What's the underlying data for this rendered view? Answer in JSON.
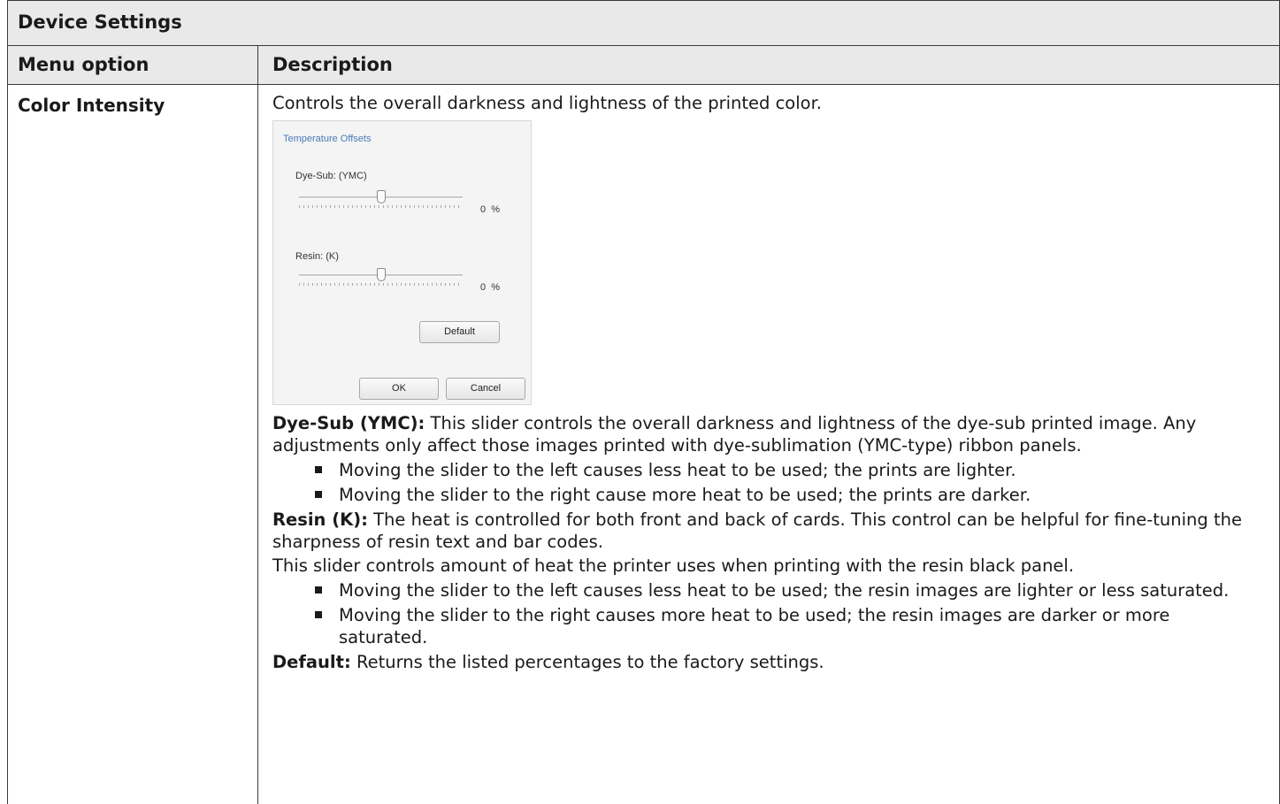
{
  "table": {
    "title": "Device Settings",
    "columns": [
      "Menu option",
      "Description"
    ],
    "row": {
      "option": "Color Intensity",
      "intro": "Controls the overall darkness and lightness of the printed color."
    }
  },
  "dialog": {
    "group_title": "Temperature Offsets",
    "dye_label": "Dye-Sub: (YMC)",
    "dye_value": "0",
    "resin_label": "Resin: (K)",
    "resin_value": "0",
    "unit": "%",
    "default_btn": "Default",
    "ok_btn": "OK",
    "cancel_btn": "Cancel"
  },
  "text": {
    "dye_title": "Dye-Sub (YMC):",
    "dye_desc": " This slider controls the overall darkness and lightness of the dye-sub printed image. Any adjustments only affect those images printed with dye-sublimation (YMC-type) ribbon panels.",
    "dye_bullets": [
      "Moving the slider to the left causes less heat to be used; the prints are lighter.",
      "Moving the slider to the right cause more heat to be used; the prints are darker."
    ],
    "resin_title": "Resin (K):",
    "resin_desc": " The heat is controlled for both front and back of cards. This control can be helpful for fine-tuning the sharpness of resin text and bar codes.",
    "resin_para": "This slider controls amount of heat the printer uses when printing with the resin black panel.",
    "resin_bullets": [
      "Moving the slider to the left causes less heat to be used; the resin images are lighter or less saturated.",
      "Moving the slider to the right causes more heat to be used; the resin images are darker or more saturated."
    ],
    "default_title": "Default:",
    "default_desc": " Returns the listed percentages to the factory settings."
  }
}
